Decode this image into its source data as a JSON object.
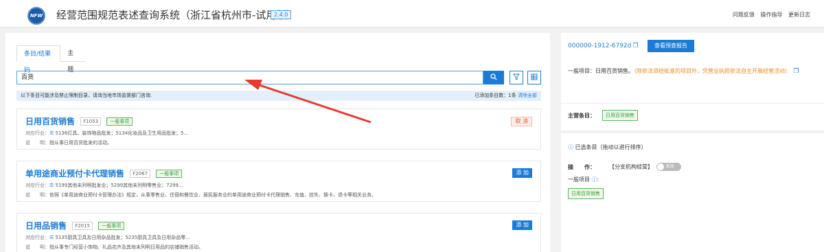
{
  "header": {
    "logo_text": "NFW",
    "title": "经营范围规范表述查询系统（浙江省杭州市-试用版）",
    "version": "2.4.0",
    "links": [
      "问题反馈",
      "操作指导",
      "更新日志"
    ]
  },
  "tabs": [
    "条目/结果码",
    "主题"
  ],
  "search": {
    "value": "百货",
    "search_icon": "search-icon",
    "filter_icon": "filter-icon",
    "grid_icon": "grid-icon"
  },
  "notice": {
    "text": "以下条目可能涉及禁止限制目录，请询当地市场监督部门咨询.",
    "count_text": "已添加条目数：1条",
    "clear_label": "清除全部"
  },
  "results": [
    {
      "title": "日用百货销售",
      "code": "F1053",
      "type": "一般事项",
      "industry_label": "对应行业：",
      "industry_value": "5136灯具、装饰物品批发；5134化妆品及卫生用品批发；5...",
      "desc_label": "说　　明：",
      "desc_value": "指从事日用百货批发的活动。",
      "action": "取 消"
    },
    {
      "title": "单用途商业预付卡代理销售",
      "code": "F2067",
      "type": "一般事项",
      "industry_label": "对应行业：",
      "industry_value": "5199其他未列明批发业；5299其他未列明零售业；7299...",
      "desc_label": "说　　明：",
      "desc_value": "依照《单用途商业预付卡管理办法》规定，从事零售业、住宿和餐饮业、居民服务业的单用途商业预付卡代理销售、充值、挂失、换卡、退卡等相关业务。",
      "action": "添 加"
    },
    {
      "title": "日用品销售",
      "code": "F2015",
      "type": "一般事项",
      "industry_label": "对应行业：",
      "industry_value": "5135厨具卫具及日用杂品批发；5235厨具卫具及日用杂品零...",
      "desc_label": "说　　明：",
      "desc_value": "指从事专门经营小饰物、礼品花卉及其他未列明日用品的店铺销售活动。",
      "action": "添 加"
    }
  ],
  "report": {
    "id": "000000-1912-6792d",
    "button": "查看预查报告",
    "general_prefix": "一般项目：日用百货销售。",
    "general_note": "（除依法须经批准的项目外，凭营业执照依法自主开展经营活动）"
  },
  "main_item": {
    "label": "主营条目：",
    "tag": "日用百货销售"
  },
  "selected": {
    "heading": "已选条目（拖动以进行排序）",
    "op_label": "操　　作：",
    "op_value": "【分支机构经营】",
    "toggle_label": "关闭",
    "general_label": "一般项目",
    "tag": "日用百货销售"
  },
  "colors": {
    "accent": "#1c7cd5",
    "green": "#5cb85c",
    "orange": "#e8891c",
    "arrow": "#e63b2e"
  }
}
